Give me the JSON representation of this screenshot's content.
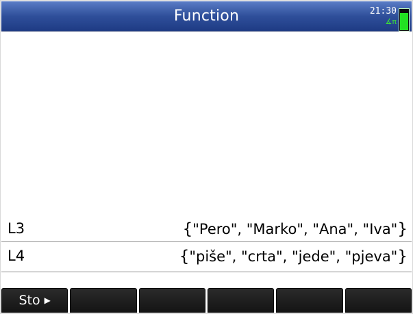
{
  "header": {
    "title": "Function",
    "time": "21:30",
    "angle_mode": "∡π"
  },
  "lists": [
    {
      "name": "L3",
      "value": "\"Pero\", \"Marko\", \"Ana\", \"Iva\""
    },
    {
      "name": "L4",
      "value": "\"piše\", \"crta\", \"jede\", \"pjeva\""
    }
  ],
  "softkeys": [
    {
      "label": "Sto",
      "icon": "arrow-right-icon"
    },
    {
      "label": ""
    },
    {
      "label": ""
    },
    {
      "label": ""
    },
    {
      "label": ""
    },
    {
      "label": ""
    }
  ],
  "colors": {
    "titlebar": "#2f4f9a",
    "battery": "#22e022"
  },
  "battery_level": 0.85
}
